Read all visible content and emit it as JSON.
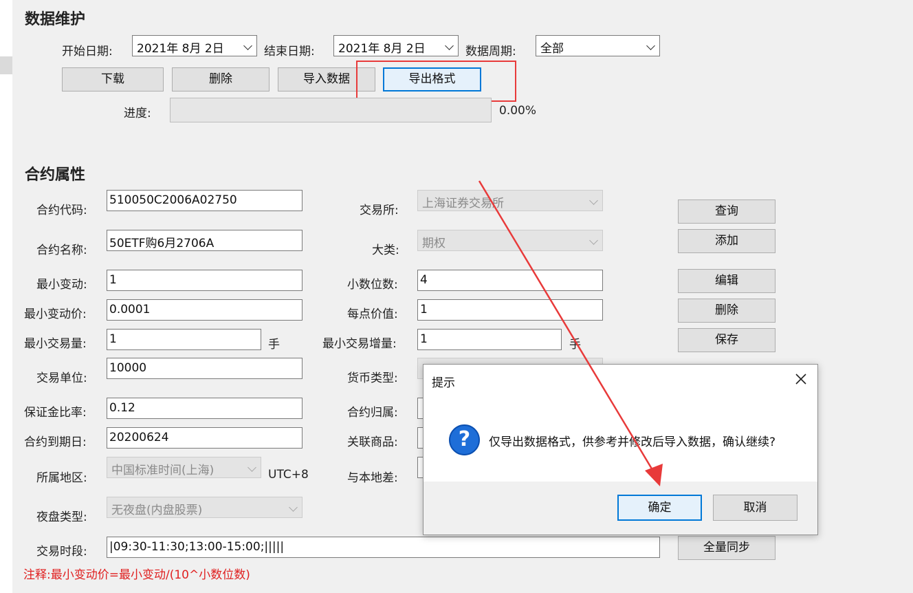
{
  "maintenance": {
    "title": "数据维护",
    "start_date_label": "开始日期:",
    "start_date": "2021年  8月  2日",
    "end_date_label": "结束日期:",
    "end_date": "2021年  8月  2日",
    "period_label": "数据周期:",
    "period": "全部",
    "buttons": {
      "download": "下载",
      "delete": "删除",
      "import": "导入数据",
      "export_format": "导出格式"
    },
    "progress_label": "进度:",
    "progress_value": 0.0,
    "progress_text": "0.00%"
  },
  "contract": {
    "title": "合约属性",
    "code_label": "合约代码:",
    "code": "510050C2006A02750",
    "exchange_label": "交易所:",
    "exchange": "上海证券交易所",
    "name_label": "合约名称:",
    "name": "50ETF购6月2706A",
    "category_label": "大类:",
    "category": "期权",
    "min_tick_label": "最小变动:",
    "min_tick": "1",
    "decimals_label": "小数位数:",
    "decimals": "4",
    "min_price_label": "最小变动价:",
    "min_price": "0.0001",
    "point_value_label": "每点价值:",
    "point_value": "1",
    "min_volume_label": "最小交易量:",
    "min_volume": "1",
    "min_volume_unit": "手",
    "min_increment_label": "最小交易增量:",
    "min_increment": "1",
    "min_increment_unit": "手",
    "trade_unit_label": "交易单位:",
    "trade_unit": "10000",
    "currency_label": "货币类型:",
    "margin_label": "保证金比率:",
    "margin": "0.12",
    "owner_label": "合约归属:",
    "expiry_label": "合约到期日:",
    "expiry": "20200624",
    "related_label": "关联商品:",
    "region_label": "所属地区:",
    "region": "中国标准时间(上海)",
    "utc": "UTC+8",
    "local_diff_label": "与本地差:",
    "night_label": "夜盘类型:",
    "night": "无夜盘(内盘股票)",
    "session_label": "交易时段:",
    "session": "|09:30-11:30;13:00-15:00;|||||",
    "buttons": {
      "query": "查询",
      "add": "添加",
      "edit": "编辑",
      "delete": "删除",
      "save": "保存",
      "sync": "全量同步"
    }
  },
  "note": "注释:最小变动价=最小变动/(10^小数位数)",
  "dialog": {
    "title": "提示",
    "message": "仅导出数据格式，供参考并修改后导入数据，确认继续?",
    "ok": "确定",
    "cancel": "取消"
  },
  "colors": {
    "accent": "#0078d7",
    "annotation_red": "#e83a3a",
    "note_red": "#e02020"
  }
}
